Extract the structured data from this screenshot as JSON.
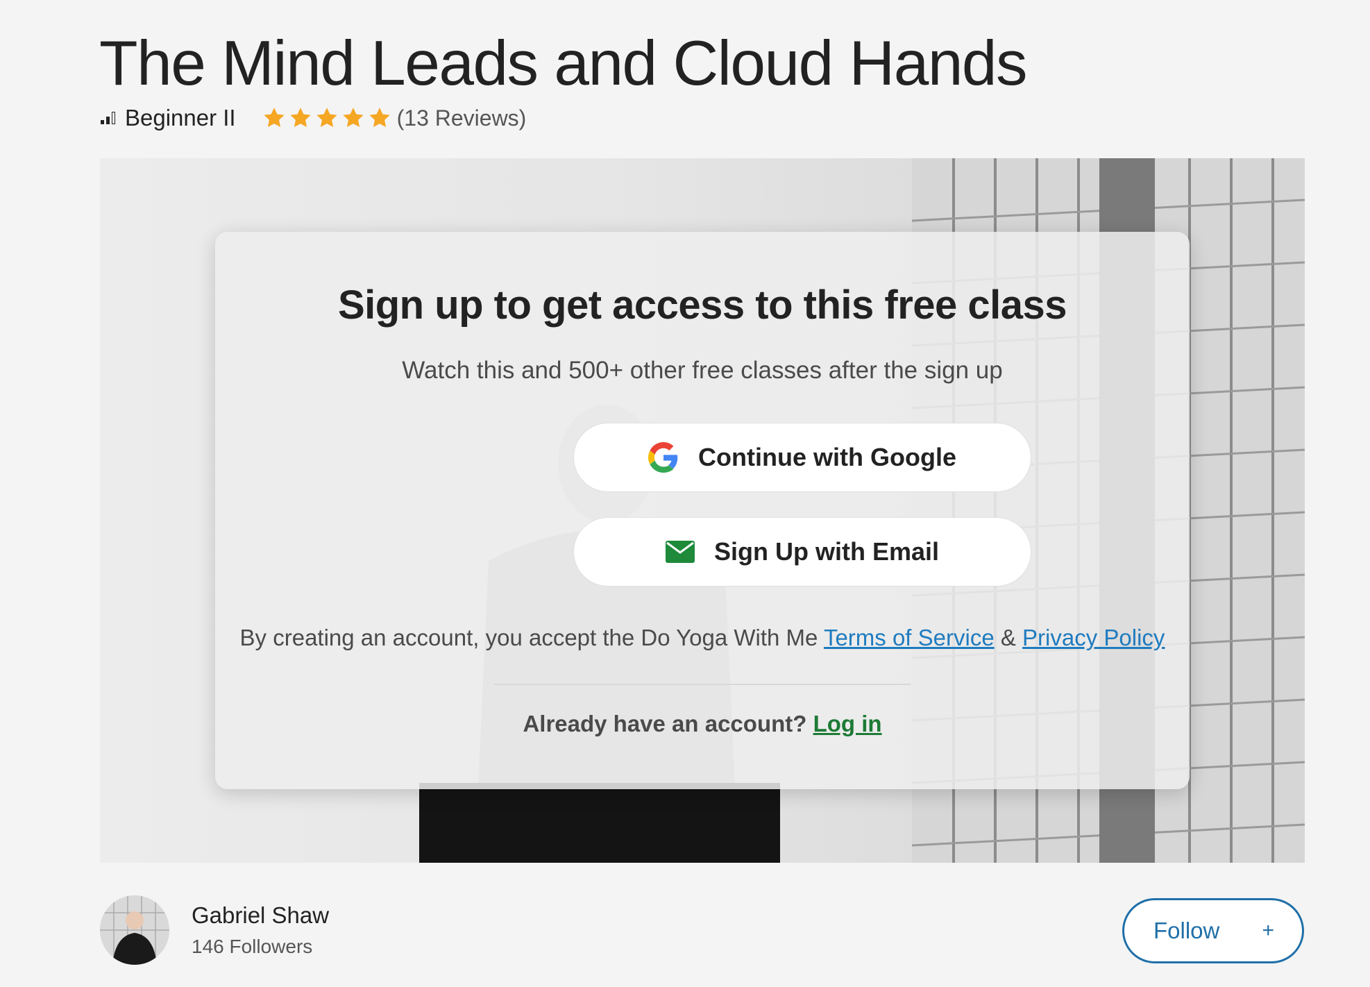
{
  "class": {
    "title": "The Mind Leads and Cloud Hands",
    "level": "Beginner II",
    "rating_stars": 5,
    "reviews": "(13 Reviews)"
  },
  "signup_modal": {
    "title": "Sign up to get access to this free class",
    "subtitle": "Watch this and 500+ other free classes after the sign up",
    "google_button": "Continue with Google",
    "email_button": "Sign Up with Email",
    "terms_prefix": "By creating an account, you accept the Do Yoga With Me ",
    "terms_link": "Terms of Service",
    "terms_and": " & ",
    "privacy_link": "Privacy Policy",
    "login_prompt": "Already have an account? ",
    "login_link": "Log in"
  },
  "author": {
    "name": "Gabriel Shaw",
    "followers": "146 Followers"
  },
  "follow_button": {
    "label": "Follow",
    "icon": "+"
  },
  "colors": {
    "star": "#f5a623",
    "link_blue": "#1f7bbf",
    "login_green": "#1d7a35",
    "email_icon_green": "#1e8a3a",
    "follow_blue": "#1f6fa8"
  }
}
